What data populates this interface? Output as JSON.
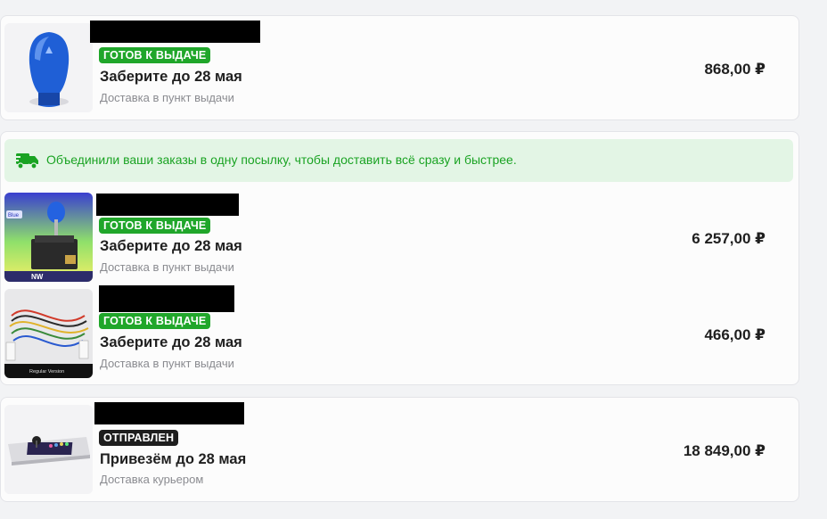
{
  "orders": [
    {
      "status": "ГОТОВ К ВЫДАЧЕ",
      "pickup": "Заберите до 28 мая",
      "delivery": "Доставка в пункт выдачи",
      "price": "868,00 ₽"
    }
  ],
  "bundle": {
    "banner": "Объединили ваши заказы в одну посылку, чтобы доставить всё сразу и быстрее.",
    "items": [
      {
        "status": "ГОТОВ К ВЫДАЧЕ",
        "pickup": "Заберите до 28 мая",
        "delivery": "Доставка в пункт выдачи",
        "price": "6 257,00 ₽",
        "thumb_label_corner": "Blue",
        "thumb_label_bottom": "NW"
      },
      {
        "status": "ГОТОВ К ВЫДАЧЕ",
        "pickup": "Заберите до 28 мая",
        "delivery": "Доставка в пункт выдачи",
        "price": "466,00 ₽",
        "thumb_caption": "Regular Version"
      }
    ]
  },
  "shipped": {
    "status": "ОТПРАВЛЕН",
    "pickup": "Привезём до 28 мая",
    "delivery": "Доставка курьером",
    "price": "18 849,00 ₽"
  },
  "colors": {
    "status_green": "#20a62a",
    "status_dark": "#1e1e1e",
    "banner_bg": "#e3f5e5",
    "banner_text": "#1aa323"
  }
}
